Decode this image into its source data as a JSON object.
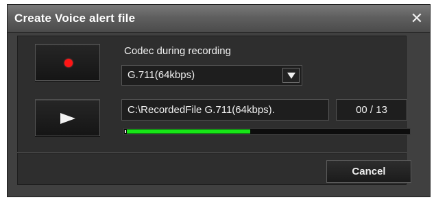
{
  "dialog": {
    "title": "Create Voice alert file",
    "close_glyph": "✕"
  },
  "record": {
    "icon": "record-dot-icon",
    "color": "#ff1515"
  },
  "playback": {
    "icon": "play-icon"
  },
  "codec": {
    "label": "Codec during recording",
    "selected": "G.711(64kbps)"
  },
  "file": {
    "path": "C:\\RecordedFile  G.711(64kbps).",
    "counter": "00 / 13"
  },
  "progress": {
    "fraction": 0.44,
    "fill_color": "#17e617"
  },
  "footer": {
    "cancel_label": "Cancel"
  }
}
